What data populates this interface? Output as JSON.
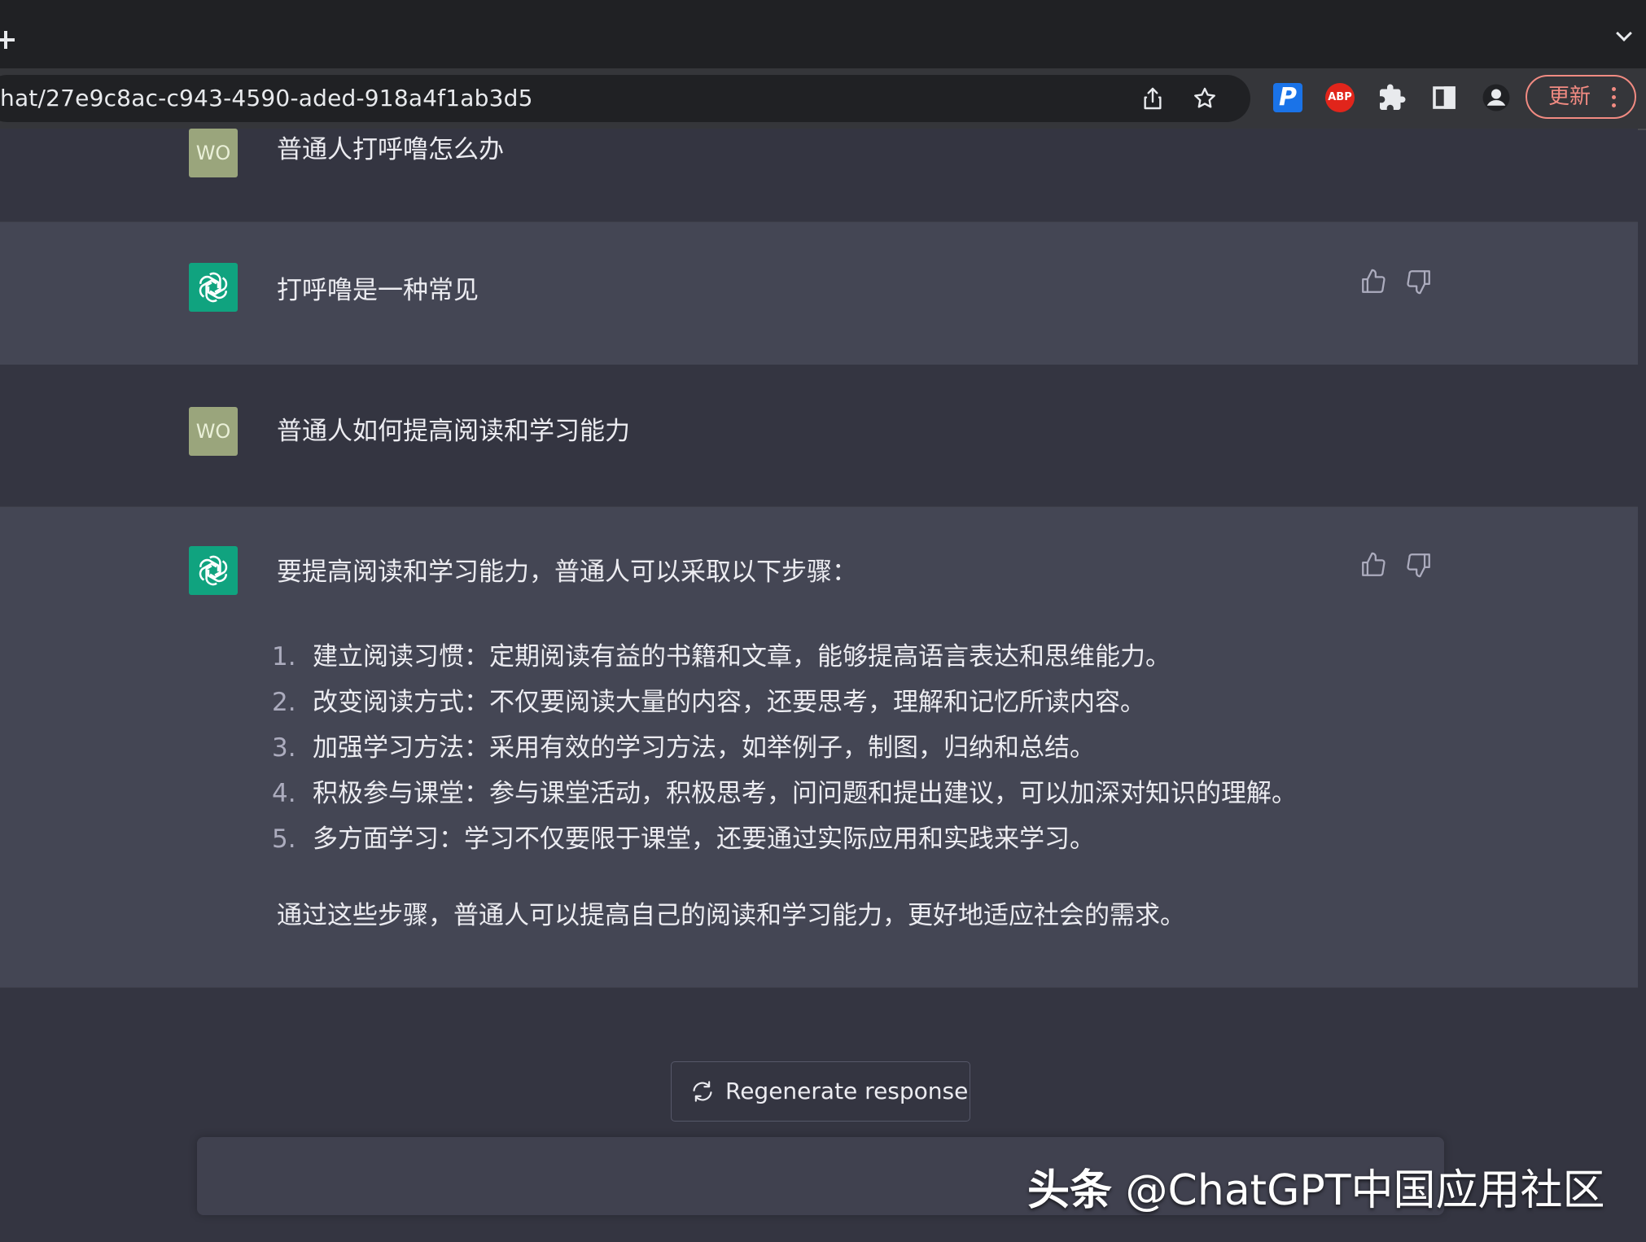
{
  "browser": {
    "url": "hat/27e9c8ac-c943-4590-aded-918a4f1ab3d5",
    "extensions": {
      "p_label": "P",
      "abp_label": "ABP"
    },
    "update_label": "更新"
  },
  "conversation": [
    {
      "role": "user",
      "avatar": "WO",
      "text": "普通人打呼噜怎么办"
    },
    {
      "role": "assistant",
      "text": "打呼噜是一种常见"
    },
    {
      "role": "user",
      "avatar": "WO",
      "text": "普通人如何提高阅读和学习能力"
    },
    {
      "role": "assistant",
      "intro": "要提高阅读和学习能力，普通人可以采取以下步骤：",
      "steps": [
        {
          "num": "1.",
          "text": "建立阅读习惯：定期阅读有益的书籍和文章，能够提高语言表达和思维能力。"
        },
        {
          "num": "2.",
          "text": "改变阅读方式：不仅要阅读大量的内容，还要思考，理解和记忆所读内容。"
        },
        {
          "num": "3.",
          "text": "加强学习方法：采用有效的学习方法，如举例子，制图，归纳和总结。"
        },
        {
          "num": "4.",
          "text": "积极参与课堂：参与课堂活动，积极思考，问问题和提出建议，可以加深对知识的理解。"
        },
        {
          "num": "5.",
          "text": "多方面学习：学习不仅要限于课堂，还要通过实际应用和实践来学习。"
        }
      ],
      "conclusion": "通过这些步骤，普通人可以提高自己的阅读和学习能力，更好地适应社会的需求。"
    }
  ],
  "regenerate_label": "Regenerate response",
  "watermark": {
    "brand": "头条",
    "handle": "@ChatGPT中国应用社区"
  },
  "colors": {
    "background": "#343541",
    "assistant_row": "#444654",
    "user_avatar": "#9aa57c",
    "assistant_avatar": "#10a37f",
    "update_accent": "#f28b82"
  }
}
